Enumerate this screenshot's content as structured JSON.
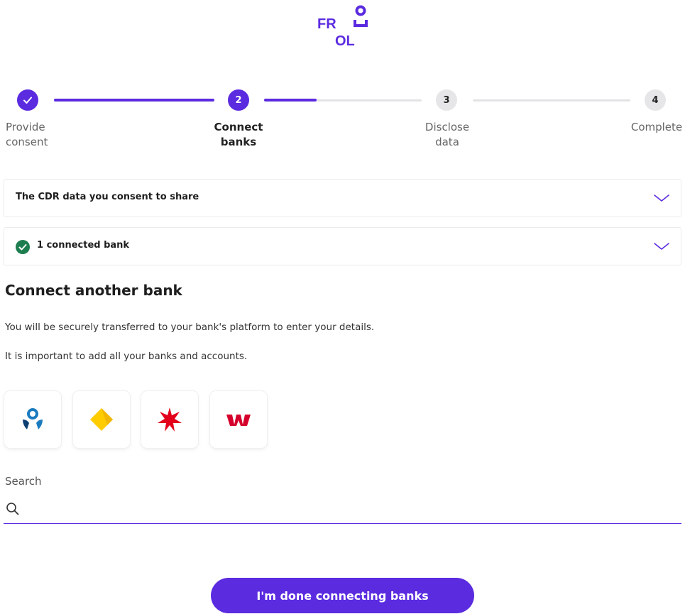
{
  "brand": {
    "logo_text": "FROLO",
    "accent_color": "#5b2be0"
  },
  "stepper": {
    "steps": [
      {
        "number": "",
        "line1": "Provide",
        "line2": "consent",
        "state": "completed"
      },
      {
        "number": "2",
        "line1": "Connect",
        "line2": "banks",
        "state": "current"
      },
      {
        "number": "3",
        "line1": "Disclose",
        "line2": "data",
        "state": "upcoming"
      },
      {
        "number": "4",
        "line1": "Complete",
        "line2": "",
        "state": "upcoming"
      }
    ]
  },
  "accordions": {
    "cdr_data": {
      "title": "The CDR data you consent to share",
      "icon": "chevron-down-icon"
    },
    "connected_banks": {
      "title": "1 connected bank",
      "status_icon": "check-circle-icon",
      "status_color": "#1e7d4f"
    }
  },
  "connect": {
    "title": "Connect another bank",
    "body1": "You will be securely transferred to your bank's platform to enter your details.",
    "body2": "It is important to add all your banks and accounts."
  },
  "banks": [
    {
      "icon": "bank-logo-blue-person-icon"
    },
    {
      "icon": "bank-logo-yellow-diamond-icon"
    },
    {
      "icon": "bank-logo-red-star-icon"
    },
    {
      "icon": "bank-logo-red-w-icon"
    }
  ],
  "search": {
    "label": "Search",
    "value": "",
    "placeholder": "",
    "icon": "search-icon"
  },
  "actions": {
    "done_label": "I'm done connecting banks"
  }
}
